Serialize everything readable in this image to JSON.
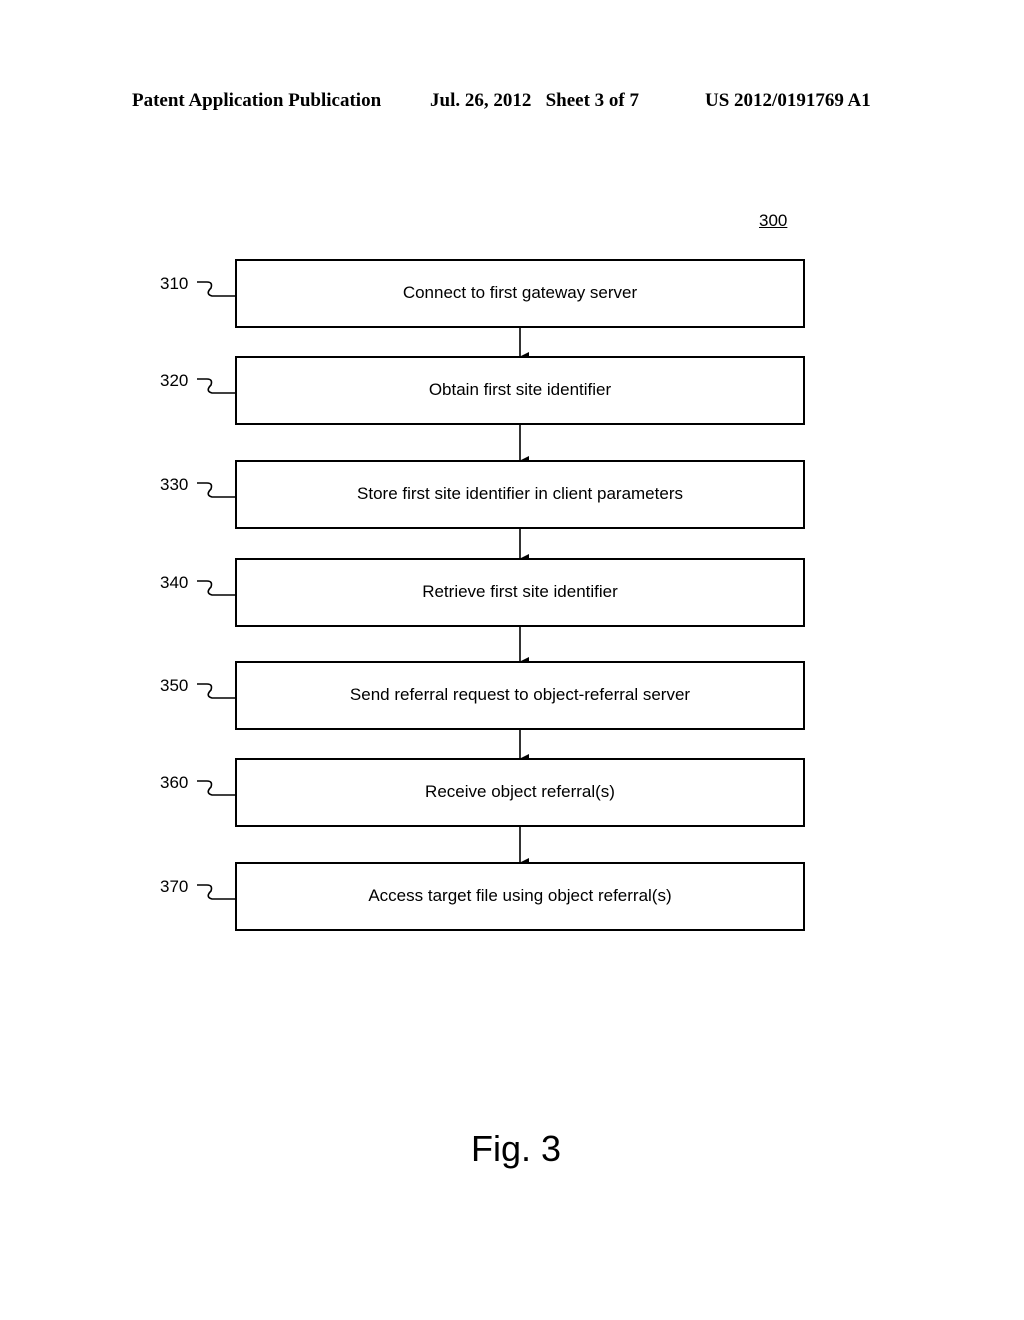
{
  "header": {
    "publication_type": "Patent Application Publication",
    "date_sheet": "Jul. 26, 2012   Sheet 3 of 7",
    "patent_number": "US 2012/0191769 A1"
  },
  "figure": {
    "reference_number": "300",
    "caption": "Fig. 3",
    "steps": [
      {
        "ref": "310",
        "label": "Connect to first gateway server"
      },
      {
        "ref": "320",
        "label": "Obtain first site identifier"
      },
      {
        "ref": "330",
        "label": "Store first site identifier in client parameters"
      },
      {
        "ref": "340",
        "label": "Retrieve first site identifier"
      },
      {
        "ref": "350",
        "label": "Send referral request to object-referral server"
      },
      {
        "ref": "360",
        "label": "Receive object referral(s)"
      },
      {
        "ref": "370",
        "label": "Access target file using object referral(s)"
      }
    ]
  }
}
